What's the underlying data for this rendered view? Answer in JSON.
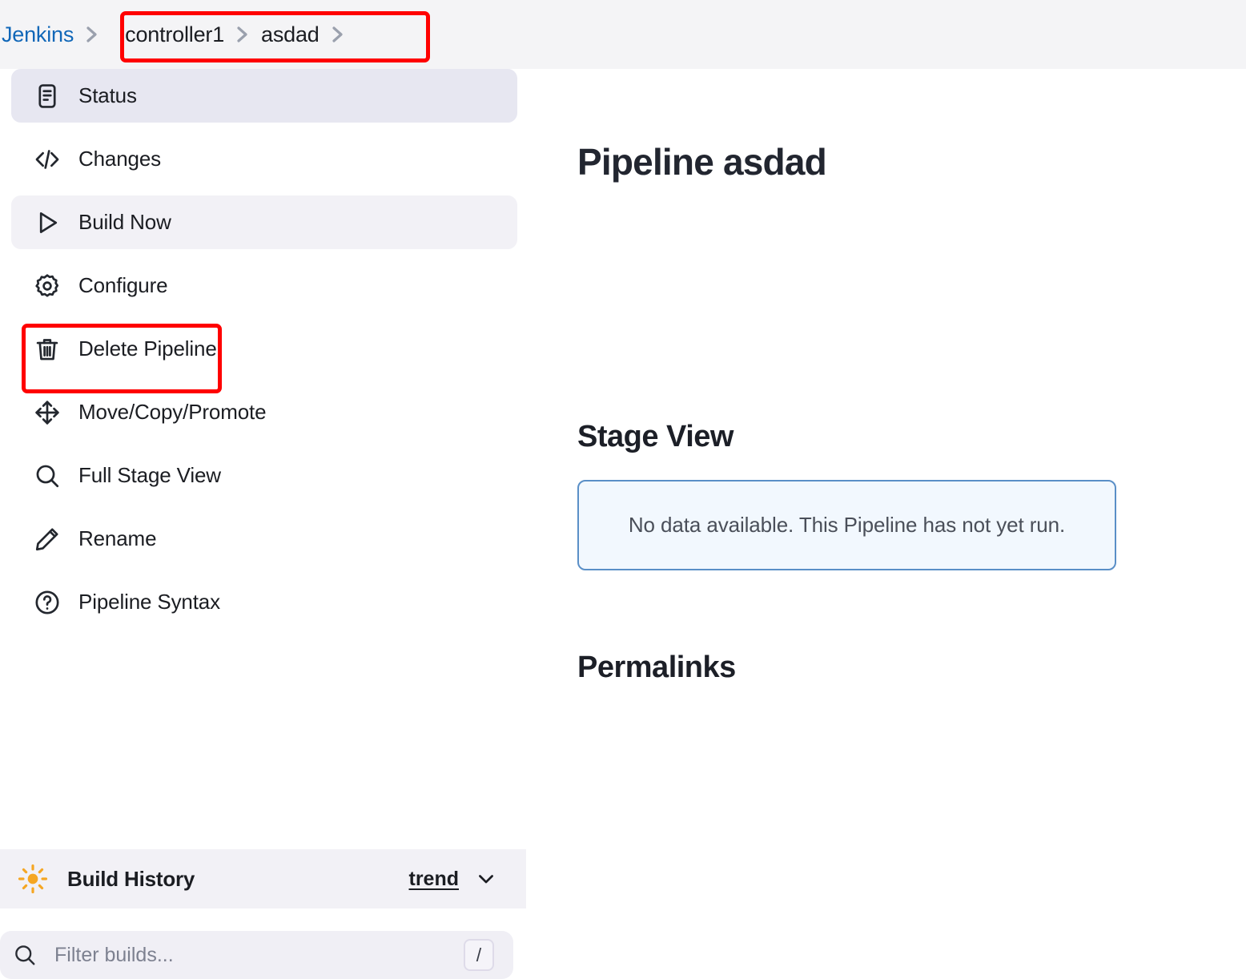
{
  "header": {
    "breadcrumb": [
      {
        "label": "Jenkins",
        "type": "link",
        "icon": "chevron-right-icon"
      },
      {
        "label": "controller1",
        "type": "text",
        "icon": "chevron-right-icon"
      },
      {
        "label": "asdad",
        "type": "text",
        "icon": "chevron-right-icon"
      }
    ]
  },
  "annotations": {
    "breadcrumb_highlight_color": "#ff0000",
    "configure_highlight_color": "#ff0000"
  },
  "sidebar": {
    "items": [
      {
        "label": "Status",
        "icon": "document-icon",
        "state": "selected"
      },
      {
        "label": "Changes",
        "icon": "code-icon",
        "state": "default"
      },
      {
        "label": "Build Now",
        "icon": "play-icon",
        "state": "hover"
      },
      {
        "label": "Configure",
        "icon": "gear-icon",
        "state": "default"
      },
      {
        "label": "Delete Pipeline",
        "icon": "trash-icon",
        "state": "default"
      },
      {
        "label": "Move/Copy/Promote",
        "icon": "move-arrows-icon",
        "state": "default"
      },
      {
        "label": "Full Stage View",
        "icon": "search-icon",
        "state": "default"
      },
      {
        "label": "Rename",
        "icon": "pencil-icon",
        "state": "default"
      },
      {
        "label": "Pipeline Syntax",
        "icon": "question-circle-icon",
        "state": "default"
      }
    ],
    "build_history": {
      "title": "Build History",
      "icon": "sun-icon",
      "icon_color": "#f5a623",
      "trend_label": "trend",
      "chevron_icon": "chevron-down-icon"
    },
    "filter": {
      "placeholder": "Filter builds...",
      "value": "",
      "search_icon": "search-icon",
      "shortcut_key": "/"
    }
  },
  "main": {
    "page_title": "Pipeline asdad",
    "stage_view": {
      "heading": "Stage View",
      "empty_message": "No data available. This Pipeline has not yet run.",
      "empty_bg_color": "#f2f8fe",
      "empty_border_color": "#5a8fc7"
    },
    "permalinks": {
      "heading": "Permalinks"
    }
  },
  "colors": {
    "link": "#1067b8",
    "header_bg": "#f4f4f6",
    "selected_item_bg": "#e7e7f1",
    "hover_item_bg": "#f2f1f6"
  }
}
